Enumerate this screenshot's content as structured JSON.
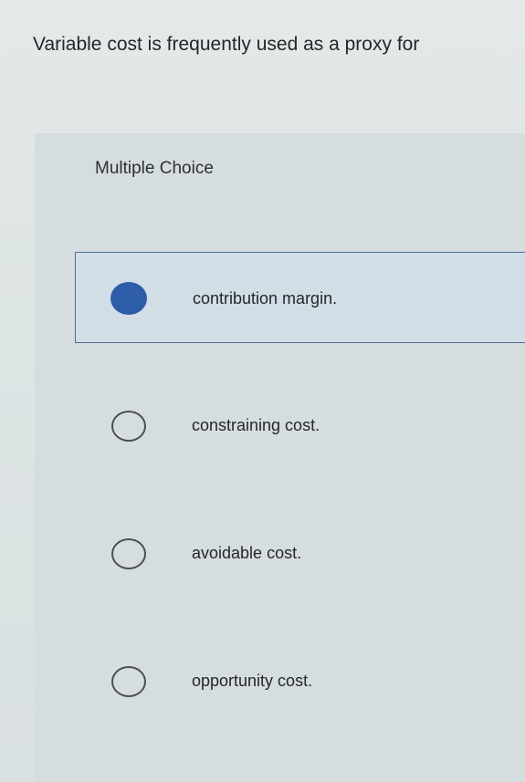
{
  "question": {
    "text": "Variable cost is frequently used as a proxy for"
  },
  "section": {
    "header": "Multiple Choice"
  },
  "options": [
    {
      "label": "contribution margin.",
      "selected": true
    },
    {
      "label": "constraining cost.",
      "selected": false
    },
    {
      "label": "avoidable cost.",
      "selected": false
    },
    {
      "label": "opportunity cost.",
      "selected": false
    }
  ],
  "colors": {
    "radio_selected": "#2d5da8",
    "selected_border": "#4e6f93",
    "selected_background": "#d2dee6"
  }
}
